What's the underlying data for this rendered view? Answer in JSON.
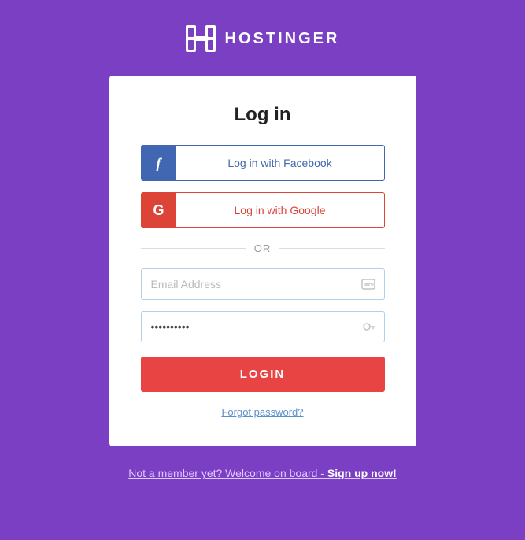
{
  "logo": {
    "text": "HOSTINGER"
  },
  "card": {
    "title": "Log in",
    "facebook_button": "Log in with Facebook",
    "google_button": "Log in with Google",
    "or_label": "OR",
    "email_placeholder": "Email Address",
    "password_value": "··········",
    "login_button": "LOGIN",
    "forgot_password": "Forgot password?"
  },
  "footer": {
    "text_prefix": "Not a member yet? Welcome on board - ",
    "signup_label": "Sign up now!"
  }
}
